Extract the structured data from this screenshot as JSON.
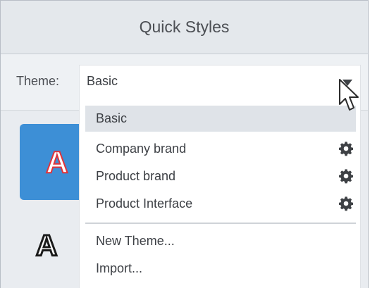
{
  "header": {
    "title": "Quick Styles"
  },
  "theme": {
    "label": "Theme:",
    "selected": "Basic"
  },
  "menu": {
    "items": [
      {
        "label": "Basic",
        "selected": true,
        "icon": null
      },
      {
        "label": "Company brand",
        "icon": "gear-icon"
      },
      {
        "label": "Product brand",
        "icon": "gear-icon"
      },
      {
        "label": "Product Interface",
        "icon": "gear-icon"
      }
    ],
    "actions": [
      {
        "label": "New Theme..."
      },
      {
        "label": "Import..."
      }
    ]
  },
  "styles": [
    {
      "letter": "A",
      "fill": "#ffffff",
      "outline": "#e0333a",
      "background": "#3d8fd6"
    },
    {
      "letter": "A",
      "fill": "#ffffff",
      "outline": "#1b1b1b",
      "background": "#e9ecf0"
    }
  ],
  "colors": {
    "accent": "#3d8fd6",
    "panel_bg": "#e9ecf0",
    "selected_item_bg": "#dfe3e8"
  }
}
